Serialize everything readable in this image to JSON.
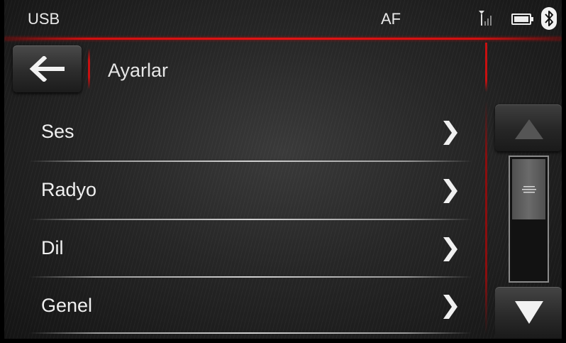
{
  "status_bar": {
    "source": "USB",
    "af": "AF",
    "signal_icon": "signal-icon",
    "battery_icon": "battery-icon",
    "bluetooth_icon": "bluetooth-icon"
  },
  "header": {
    "back_icon": "back-arrow-icon",
    "title": "Ayarlar"
  },
  "menu": {
    "items": [
      {
        "label": "Ses"
      },
      {
        "label": "Radyo"
      },
      {
        "label": "Dil"
      },
      {
        "label": "Genel"
      }
    ]
  },
  "scroll": {
    "up_icon": "triangle-up-icon",
    "down_icon": "triangle-down-icon",
    "thumb_icon": "grip-icon",
    "position": 0,
    "visible_fraction": 0.5
  },
  "colors": {
    "accent_red": "#d01010",
    "text": "#f0f0f0"
  }
}
